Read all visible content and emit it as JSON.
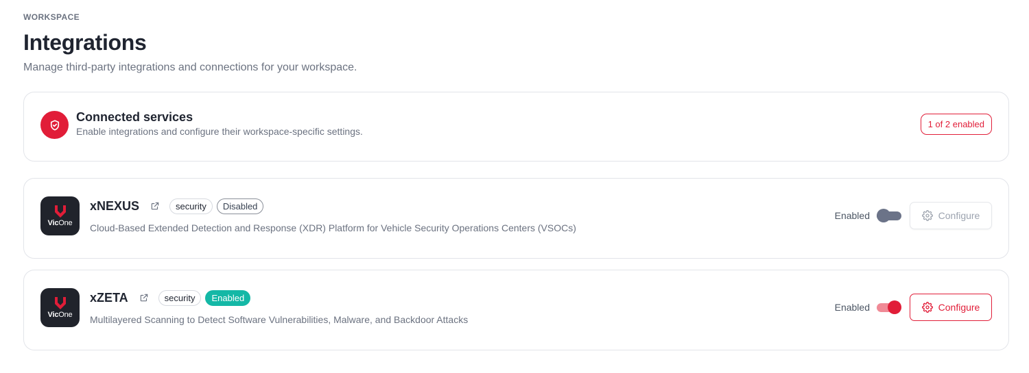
{
  "header": {
    "eyebrow": "WORKSPACE",
    "title": "Integrations",
    "subtitle": "Manage third-party integrations and connections for your workspace."
  },
  "summary": {
    "icon": "shield-check-icon",
    "title": "Connected services",
    "description": "Enable integrations and configure their workspace-specific settings.",
    "badge": "1 of 2 enabled"
  },
  "integrations": [
    {
      "name": "xNEXUS",
      "logo_text_bold": "Vic",
      "logo_text_rest": "One",
      "category": "security",
      "status": "Disabled",
      "description": "Cloud-Based Extended Detection and Response (XDR) Platform for Vehicle Security Operations Centers (VSOCs)",
      "toggle_label": "Enabled",
      "enabled": false,
      "configure_label": "Configure"
    },
    {
      "name": "xZETA",
      "logo_text_bold": "Vic",
      "logo_text_rest": "One",
      "category": "security",
      "status": "Enabled",
      "description": "Multilayered Scanning to Detect Software Vulnerabilities, Malware, and Backdoor Attacks",
      "toggle_label": "Enabled",
      "enabled": true,
      "configure_label": "Configure"
    }
  ],
  "colors": {
    "accent": "#e11d38",
    "enabled_badge": "#14b8a6",
    "toggle_off": "#6b7388",
    "logo_bg": "#20232b"
  }
}
